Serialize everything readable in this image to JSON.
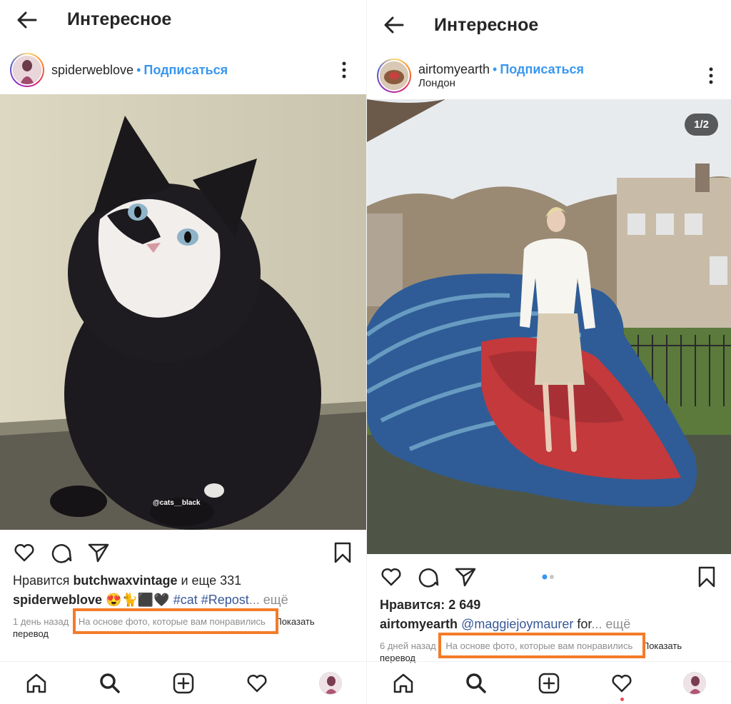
{
  "left": {
    "header_title": "Интересное",
    "post": {
      "username": "spiderweblove",
      "separator": "•",
      "follow_label": "Подписаться",
      "watermark": "@cats__black",
      "likes_prefix": "Нравится ",
      "likes_user": "butchwaxvintage",
      "likes_suffix": " и еще 331",
      "caption_user": "spiderweblove",
      "caption_emoji": " 😍🐈⬛🖤 ",
      "caption_tags": "#cat #Repost",
      "caption_more": "... ещё",
      "time": "1 день назад",
      "recommendation": "На основе фото, которые вам понравились",
      "translate_1": "Показать",
      "translate_2": "перевод"
    }
  },
  "right": {
    "header_title": "Интересное",
    "post": {
      "username": "airtomyearth",
      "separator": "•",
      "follow_label": "Подписаться",
      "location": "Лондон",
      "photo_counter": "1/2",
      "likes_label": "Нравится: 2 649",
      "caption_user": "airtomyearth",
      "caption_mention": "@maggiejoymaurer",
      "caption_text": " for",
      "caption_more": "... ещё",
      "time": "6 дней назад",
      "recommendation": "На основе фото, которые вам понравились",
      "translate_1": "Показать",
      "translate_2": "перевод"
    }
  },
  "icons": {
    "back": "arrow-left-icon",
    "more": "more-vertical-icon",
    "like": "heart-icon",
    "comment": "comment-icon",
    "share": "send-icon",
    "save": "bookmark-icon",
    "home": "home-icon",
    "search": "search-icon",
    "add": "plus-square-icon",
    "activity": "heart-icon",
    "profile": "avatar"
  },
  "colors": {
    "accent_blue": "#3897f0",
    "highlight_orange": "#f47b2a",
    "notification_red": "#ed4956"
  }
}
